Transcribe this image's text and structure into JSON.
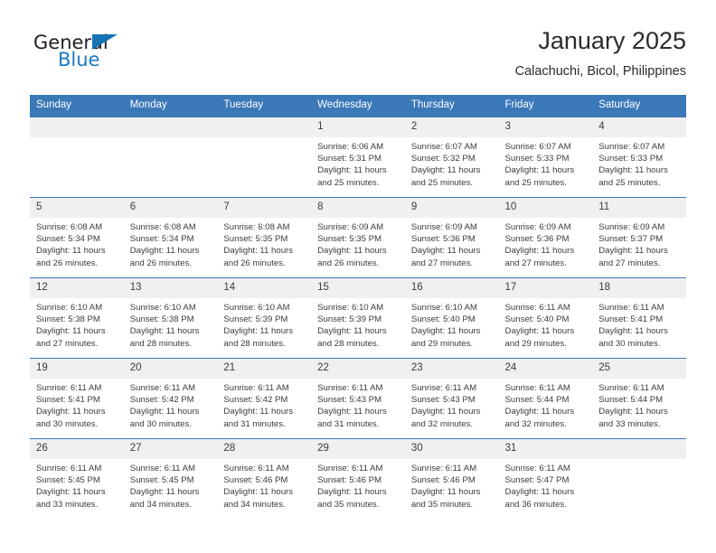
{
  "logo": {
    "word1": "General",
    "word2": "Blue",
    "icon": "flag-triangle-icon",
    "color_primary": "#1673b8",
    "color_text": "#231f20"
  },
  "header": {
    "title": "January 2025",
    "subtitle": "Calachuchi, Bicol, Philippines"
  },
  "theme": {
    "header_blue": "#3b78b8",
    "daynum_bg": "#f0f0f0",
    "text": "#3c3c3c"
  },
  "calendar": {
    "weekday_headers": [
      "Sunday",
      "Monday",
      "Tuesday",
      "Wednesday",
      "Thursday",
      "Friday",
      "Saturday"
    ],
    "weeks": [
      [
        {
          "day": "",
          "empty": true,
          "sunrise": "",
          "sunset": "",
          "daylight_line1": "",
          "daylight_line2": ""
        },
        {
          "day": "",
          "empty": true,
          "sunrise": "",
          "sunset": "",
          "daylight_line1": "",
          "daylight_line2": ""
        },
        {
          "day": "",
          "empty": true,
          "sunrise": "",
          "sunset": "",
          "daylight_line1": "",
          "daylight_line2": ""
        },
        {
          "day": "1",
          "empty": false,
          "sunrise": "Sunrise: 6:06 AM",
          "sunset": "Sunset: 5:31 PM",
          "daylight_line1": "Daylight: 11 hours",
          "daylight_line2": "and 25 minutes."
        },
        {
          "day": "2",
          "empty": false,
          "sunrise": "Sunrise: 6:07 AM",
          "sunset": "Sunset: 5:32 PM",
          "daylight_line1": "Daylight: 11 hours",
          "daylight_line2": "and 25 minutes."
        },
        {
          "day": "3",
          "empty": false,
          "sunrise": "Sunrise: 6:07 AM",
          "sunset": "Sunset: 5:33 PM",
          "daylight_line1": "Daylight: 11 hours",
          "daylight_line2": "and 25 minutes."
        },
        {
          "day": "4",
          "empty": false,
          "sunrise": "Sunrise: 6:07 AM",
          "sunset": "Sunset: 5:33 PM",
          "daylight_line1": "Daylight: 11 hours",
          "daylight_line2": "and 25 minutes."
        }
      ],
      [
        {
          "day": "5",
          "empty": false,
          "sunrise": "Sunrise: 6:08 AM",
          "sunset": "Sunset: 5:34 PM",
          "daylight_line1": "Daylight: 11 hours",
          "daylight_line2": "and 26 minutes."
        },
        {
          "day": "6",
          "empty": false,
          "sunrise": "Sunrise: 6:08 AM",
          "sunset": "Sunset: 5:34 PM",
          "daylight_line1": "Daylight: 11 hours",
          "daylight_line2": "and 26 minutes."
        },
        {
          "day": "7",
          "empty": false,
          "sunrise": "Sunrise: 6:08 AM",
          "sunset": "Sunset: 5:35 PM",
          "daylight_line1": "Daylight: 11 hours",
          "daylight_line2": "and 26 minutes."
        },
        {
          "day": "8",
          "empty": false,
          "sunrise": "Sunrise: 6:09 AM",
          "sunset": "Sunset: 5:35 PM",
          "daylight_line1": "Daylight: 11 hours",
          "daylight_line2": "and 26 minutes."
        },
        {
          "day": "9",
          "empty": false,
          "sunrise": "Sunrise: 6:09 AM",
          "sunset": "Sunset: 5:36 PM",
          "daylight_line1": "Daylight: 11 hours",
          "daylight_line2": "and 27 minutes."
        },
        {
          "day": "10",
          "empty": false,
          "sunrise": "Sunrise: 6:09 AM",
          "sunset": "Sunset: 5:36 PM",
          "daylight_line1": "Daylight: 11 hours",
          "daylight_line2": "and 27 minutes."
        },
        {
          "day": "11",
          "empty": false,
          "sunrise": "Sunrise: 6:09 AM",
          "sunset": "Sunset: 5:37 PM",
          "daylight_line1": "Daylight: 11 hours",
          "daylight_line2": "and 27 minutes."
        }
      ],
      [
        {
          "day": "12",
          "empty": false,
          "sunrise": "Sunrise: 6:10 AM",
          "sunset": "Sunset: 5:38 PM",
          "daylight_line1": "Daylight: 11 hours",
          "daylight_line2": "and 27 minutes."
        },
        {
          "day": "13",
          "empty": false,
          "sunrise": "Sunrise: 6:10 AM",
          "sunset": "Sunset: 5:38 PM",
          "daylight_line1": "Daylight: 11 hours",
          "daylight_line2": "and 28 minutes."
        },
        {
          "day": "14",
          "empty": false,
          "sunrise": "Sunrise: 6:10 AM",
          "sunset": "Sunset: 5:39 PM",
          "daylight_line1": "Daylight: 11 hours",
          "daylight_line2": "and 28 minutes."
        },
        {
          "day": "15",
          "empty": false,
          "sunrise": "Sunrise: 6:10 AM",
          "sunset": "Sunset: 5:39 PM",
          "daylight_line1": "Daylight: 11 hours",
          "daylight_line2": "and 28 minutes."
        },
        {
          "day": "16",
          "empty": false,
          "sunrise": "Sunrise: 6:10 AM",
          "sunset": "Sunset: 5:40 PM",
          "daylight_line1": "Daylight: 11 hours",
          "daylight_line2": "and 29 minutes."
        },
        {
          "day": "17",
          "empty": false,
          "sunrise": "Sunrise: 6:11 AM",
          "sunset": "Sunset: 5:40 PM",
          "daylight_line1": "Daylight: 11 hours",
          "daylight_line2": "and 29 minutes."
        },
        {
          "day": "18",
          "empty": false,
          "sunrise": "Sunrise: 6:11 AM",
          "sunset": "Sunset: 5:41 PM",
          "daylight_line1": "Daylight: 11 hours",
          "daylight_line2": "and 30 minutes."
        }
      ],
      [
        {
          "day": "19",
          "empty": false,
          "sunrise": "Sunrise: 6:11 AM",
          "sunset": "Sunset: 5:41 PM",
          "daylight_line1": "Daylight: 11 hours",
          "daylight_line2": "and 30 minutes."
        },
        {
          "day": "20",
          "empty": false,
          "sunrise": "Sunrise: 6:11 AM",
          "sunset": "Sunset: 5:42 PM",
          "daylight_line1": "Daylight: 11 hours",
          "daylight_line2": "and 30 minutes."
        },
        {
          "day": "21",
          "empty": false,
          "sunrise": "Sunrise: 6:11 AM",
          "sunset": "Sunset: 5:42 PM",
          "daylight_line1": "Daylight: 11 hours",
          "daylight_line2": "and 31 minutes."
        },
        {
          "day": "22",
          "empty": false,
          "sunrise": "Sunrise: 6:11 AM",
          "sunset": "Sunset: 5:43 PM",
          "daylight_line1": "Daylight: 11 hours",
          "daylight_line2": "and 31 minutes."
        },
        {
          "day": "23",
          "empty": false,
          "sunrise": "Sunrise: 6:11 AM",
          "sunset": "Sunset: 5:43 PM",
          "daylight_line1": "Daylight: 11 hours",
          "daylight_line2": "and 32 minutes."
        },
        {
          "day": "24",
          "empty": false,
          "sunrise": "Sunrise: 6:11 AM",
          "sunset": "Sunset: 5:44 PM",
          "daylight_line1": "Daylight: 11 hours",
          "daylight_line2": "and 32 minutes."
        },
        {
          "day": "25",
          "empty": false,
          "sunrise": "Sunrise: 6:11 AM",
          "sunset": "Sunset: 5:44 PM",
          "daylight_line1": "Daylight: 11 hours",
          "daylight_line2": "and 33 minutes."
        }
      ],
      [
        {
          "day": "26",
          "empty": false,
          "sunrise": "Sunrise: 6:11 AM",
          "sunset": "Sunset: 5:45 PM",
          "daylight_line1": "Daylight: 11 hours",
          "daylight_line2": "and 33 minutes."
        },
        {
          "day": "27",
          "empty": false,
          "sunrise": "Sunrise: 6:11 AM",
          "sunset": "Sunset: 5:45 PM",
          "daylight_line1": "Daylight: 11 hours",
          "daylight_line2": "and 34 minutes."
        },
        {
          "day": "28",
          "empty": false,
          "sunrise": "Sunrise: 6:11 AM",
          "sunset": "Sunset: 5:46 PM",
          "daylight_line1": "Daylight: 11 hours",
          "daylight_line2": "and 34 minutes."
        },
        {
          "day": "29",
          "empty": false,
          "sunrise": "Sunrise: 6:11 AM",
          "sunset": "Sunset: 5:46 PM",
          "daylight_line1": "Daylight: 11 hours",
          "daylight_line2": "and 35 minutes."
        },
        {
          "day": "30",
          "empty": false,
          "sunrise": "Sunrise: 6:11 AM",
          "sunset": "Sunset: 5:46 PM",
          "daylight_line1": "Daylight: 11 hours",
          "daylight_line2": "and 35 minutes."
        },
        {
          "day": "31",
          "empty": false,
          "sunrise": "Sunrise: 6:11 AM",
          "sunset": "Sunset: 5:47 PM",
          "daylight_line1": "Daylight: 11 hours",
          "daylight_line2": "and 36 minutes."
        },
        {
          "day": "",
          "empty": true,
          "sunrise": "",
          "sunset": "",
          "daylight_line1": "",
          "daylight_line2": ""
        }
      ]
    ]
  }
}
